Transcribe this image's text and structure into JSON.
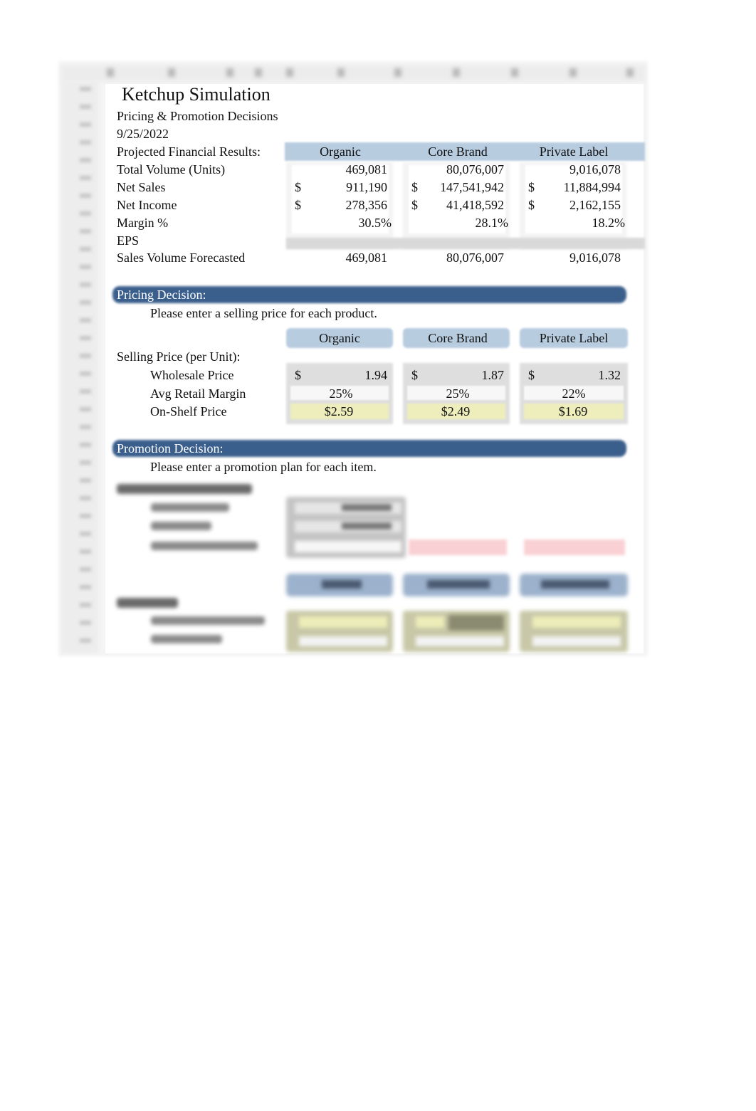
{
  "header": {
    "title": "Ketchup Simulation",
    "subtitle": "Pricing & Promotion Decisions",
    "date": "9/25/2022"
  },
  "products": [
    "Organic",
    "Core Brand",
    "Private Label"
  ],
  "financials": {
    "section_label": "Projected Financial Results:",
    "rows": [
      {
        "label": "Total Volume (Units)",
        "currency": false,
        "values": [
          "469,081",
          "80,076,007",
          "9,016,078"
        ]
      },
      {
        "label": "Net Sales",
        "currency": true,
        "values": [
          "911,190",
          "147,541,942",
          "11,884,994"
        ]
      },
      {
        "label": "Net Income",
        "currency": true,
        "values": [
          "278,356",
          "41,418,592",
          "2,162,155"
        ]
      },
      {
        "label": "Margin %",
        "currency": false,
        "values": [
          "30.5%",
          "28.1%",
          "18.2%"
        ]
      },
      {
        "label": "EPS",
        "currency": false,
        "values": [
          "",
          "",
          ""
        ]
      },
      {
        "label": "Sales Volume Forecasted",
        "currency": false,
        "values": [
          "469,081",
          "80,076,007",
          "9,016,078"
        ]
      }
    ],
    "currency_symbol": "$"
  },
  "pricing": {
    "section_title": "Pricing Decision:",
    "instruction": "Please enter a selling price for each product.",
    "group_label": "Selling Price (per Unit):",
    "wholesale": {
      "label": "Wholesale Price",
      "values": [
        "1.94",
        "1.87",
        "1.32"
      ]
    },
    "retail_margin": {
      "label": "Avg Retail Margin",
      "values": [
        "25%",
        "25%",
        "22%"
      ]
    },
    "on_shelf": {
      "label": "On-Shelf Price",
      "values": [
        "$2.59",
        "$2.49",
        "$1.69"
      ]
    }
  },
  "promotion": {
    "section_title": "Promotion Decision:",
    "instruction": "Please enter a promotion plan for each item."
  },
  "colors": {
    "header_band_light": "#b8cce0",
    "section_band_dark": "#3b5f8c",
    "input_yellow": "#eeeebc",
    "warning_pink": "#f9d0d4"
  }
}
